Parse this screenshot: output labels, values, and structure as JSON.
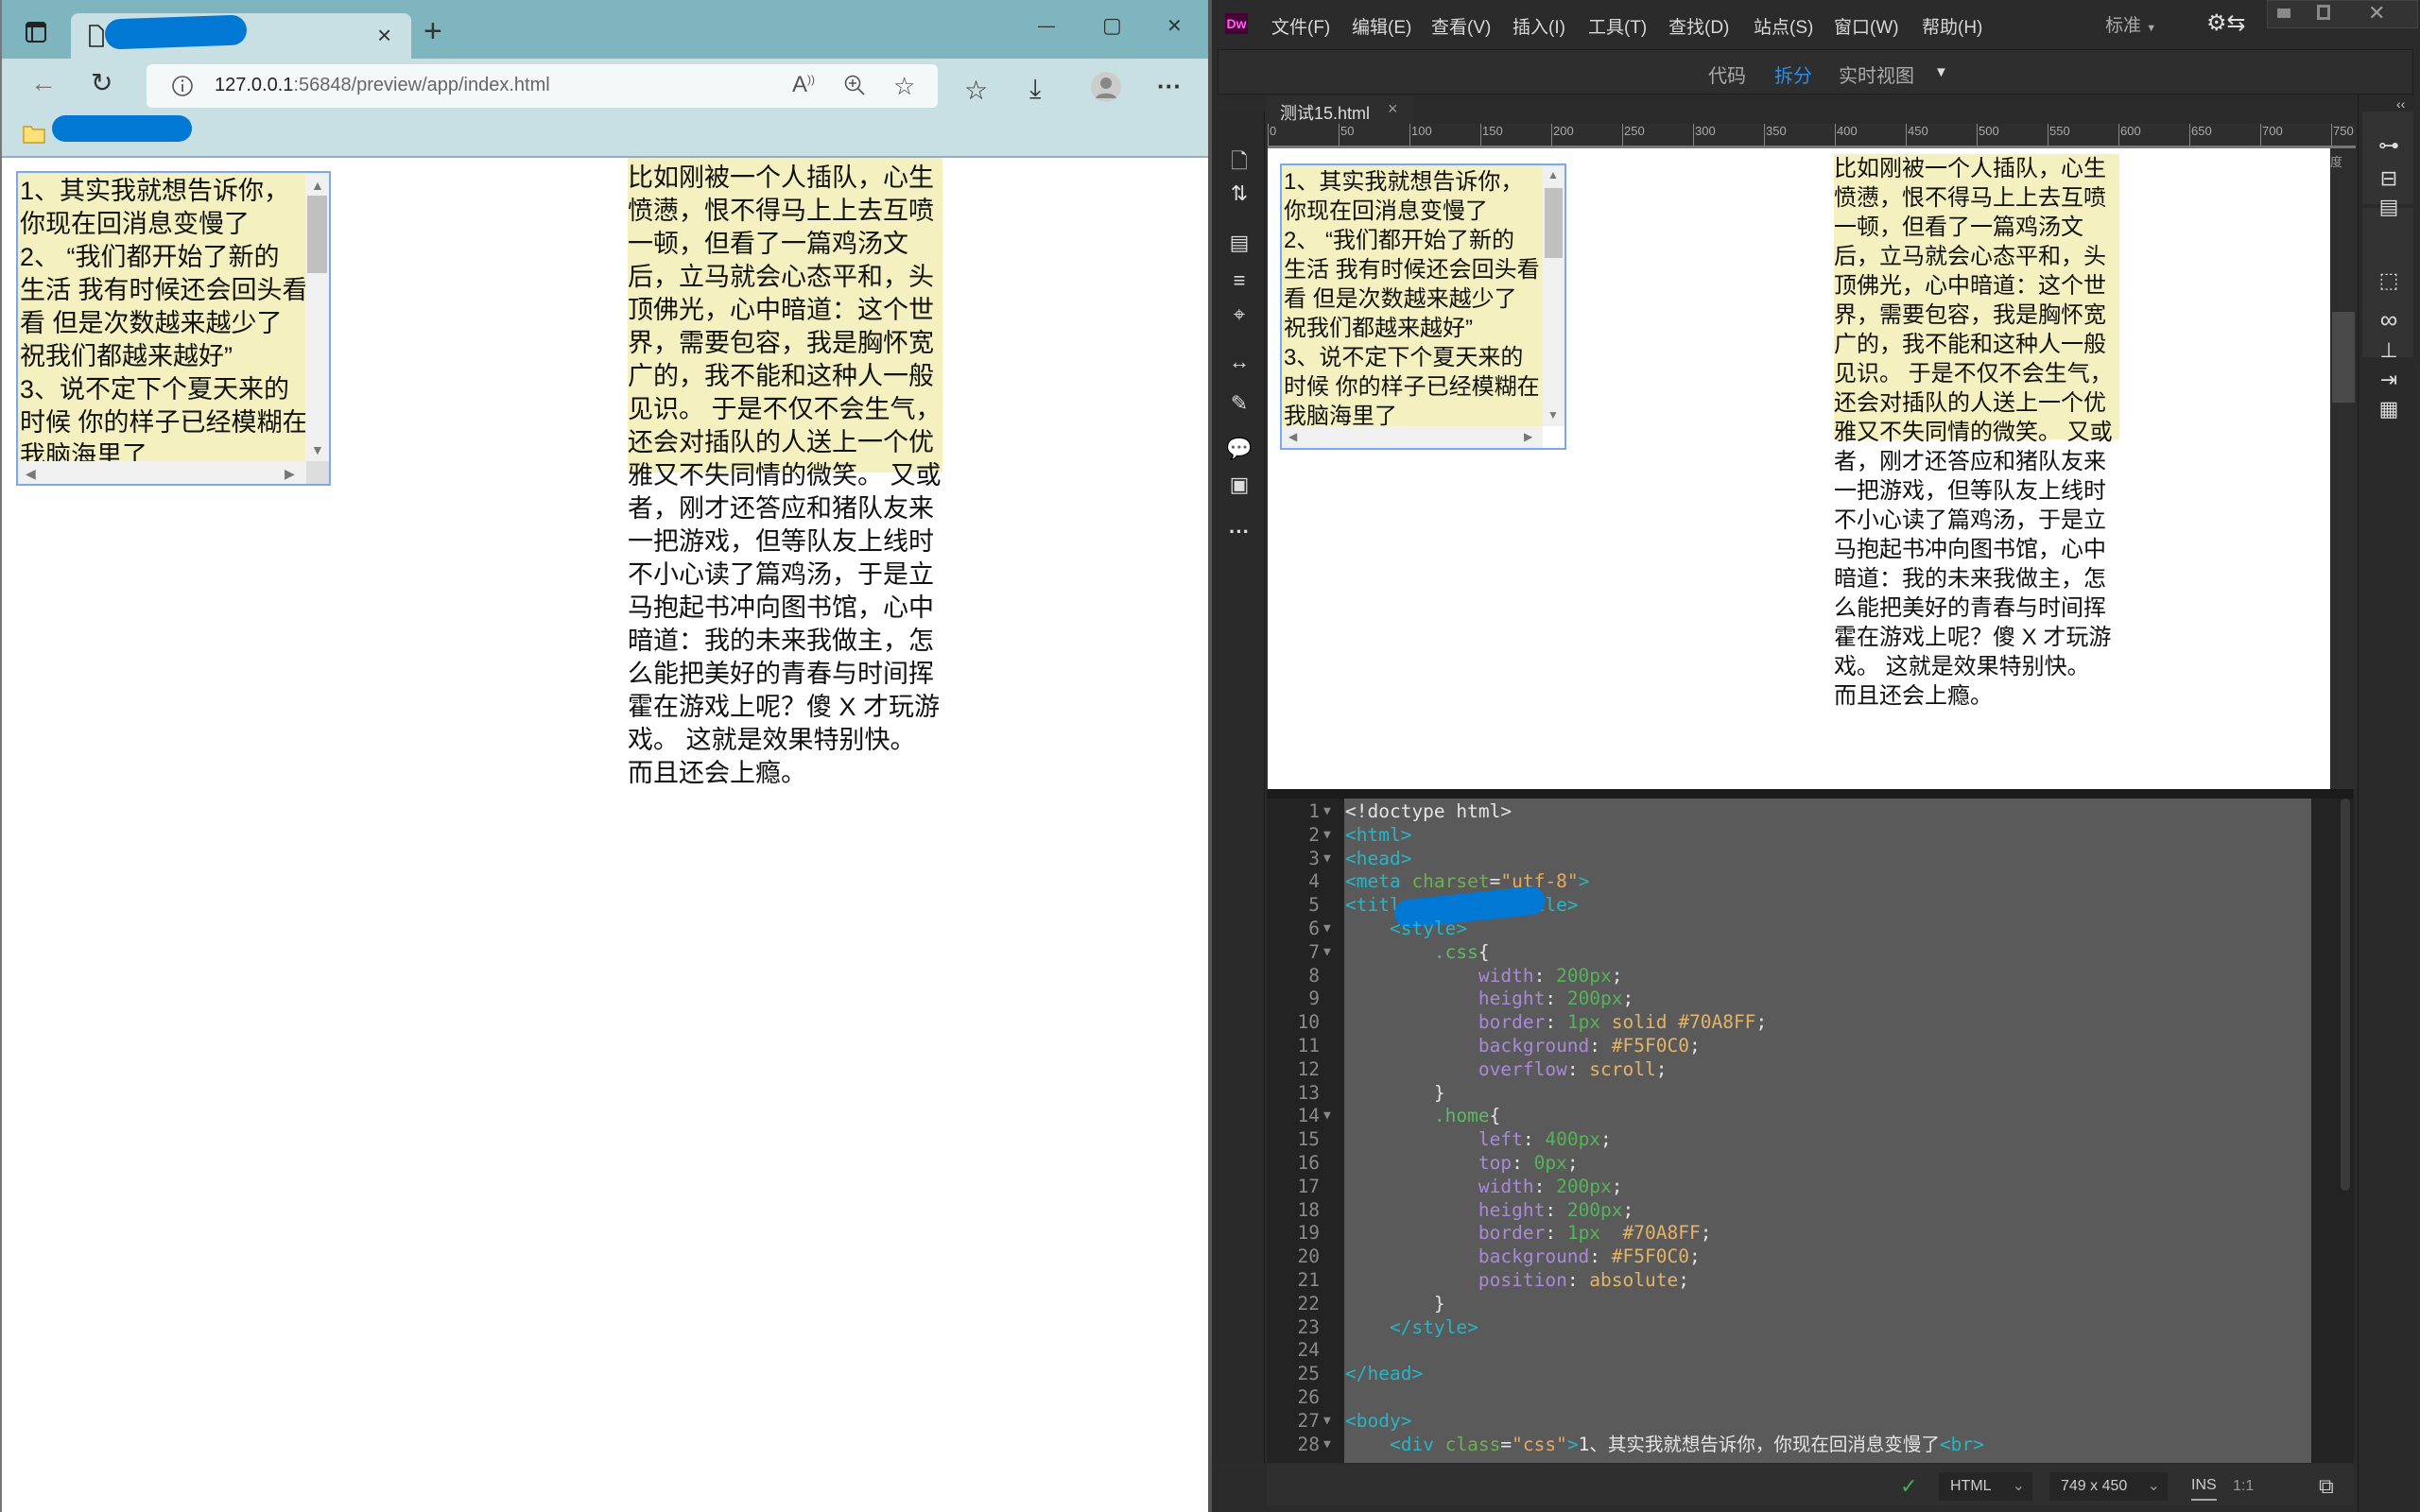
{
  "browser": {
    "tab_close": "×",
    "new_tab": "+",
    "url_host": "127.0.0.1",
    "url_path": ":56848/preview/app/index.html",
    "window": {
      "minimize": "—",
      "maximize": "▢",
      "close": "✕"
    },
    "icons": [
      "sidebar-icon",
      "page-icon",
      "back-icon",
      "refresh-icon",
      "info-icon",
      "read-aloud-icon",
      "zoom-icon",
      "add-favorite-icon",
      "favorites-icon",
      "download-icon",
      "profile-icon",
      "more-icon",
      "folder-icon"
    ],
    "more": "···"
  },
  "page": {
    "css_box_lines": [
      "1、其实我就想告诉你，",
      "你现在回消息变慢了",
      "2、 “我们都开始了新的",
      "生活 我有时候还会回头看",
      "看 但是次数越来越少了",
      "祝我们都越来越好”",
      "3、说不定下个夏天来的",
      "时候 你的样子已经模糊在",
      "我脑海里了"
    ],
    "home_lines": [
      "比如刚被一个人插队，心生",
      "愤懑，恨不得马上上去互喷",
      "一顿，但看了一篇鸡汤文",
      "后，立马就会心态平和，头",
      "顶佛光，心中暗道：这个世",
      "界，需要包容，我是胸怀宽",
      "广的，我不能和这种人一般",
      "见识。 于是不仅不会生气，",
      "还会对插队的人送上一个优",
      "雅又不失同情的微笑。 又或",
      "者，刚才还答应和猪队友来",
      "一把游戏，但等队友上线时",
      "不小心读了篇鸡汤，于是立",
      "马抱起书冲向图书馆，心中",
      "暗道：我的未来我做主，怎",
      "么能把美好的青春与时间挥",
      "霍在游戏上呢？傻 X 才玩游",
      "戏。 这就是效果特别快。",
      "而且还会上瘾。"
    ],
    "colors": {
      "box_border": "#70A8FF",
      "box_background": "#F5F0C0"
    }
  },
  "dw": {
    "logo": "Dw",
    "menu": [
      "文件(F)",
      "编辑(E)",
      "查看(V)",
      "插入(I)",
      "工具(T)",
      "查找(D)",
      "站点(S)",
      "窗口(W)",
      "帮助(H)"
    ],
    "workspace": "标准",
    "views": {
      "code": "代码",
      "split": "拆分",
      "live": "实时视图",
      "active": "拆分"
    },
    "accent": "#2d8ce6",
    "doc_tab": "测试15.html",
    "doc_tab_close": "×",
    "ruler": [
      "0",
      "50",
      "100",
      "150",
      "200",
      "250",
      "300",
      "350",
      "400",
      "450",
      "500",
      "550",
      "600",
      "650",
      "700",
      "750"
    ],
    "side_label": "度",
    "collapse": "‹‹",
    "code": {
      "lines": [
        {
          "n": "1",
          "fold": true,
          "tokens": [
            [
              "p",
              "<!doctype html>"
            ]
          ]
        },
        {
          "n": "2",
          "fold": true,
          "tokens": [
            [
              "tg",
              "<html>"
            ]
          ]
        },
        {
          "n": "3",
          "fold": true,
          "tokens": [
            [
              "tg",
              "<head>"
            ]
          ]
        },
        {
          "n": "4",
          "fold": false,
          "tokens": [
            [
              "tg",
              "<meta"
            ],
            [
              "at",
              " charset"
            ],
            [
              "p",
              "="
            ],
            [
              "st",
              "\"utf-8\""
            ],
            [
              "tg",
              ">"
            ]
          ]
        },
        {
          "n": "5",
          "fold": false,
          "tokens": [
            [
              "tg",
              "<titl"
            ],
            [
              "p",
              "          "
            ],
            [
              "tg",
              "title>"
            ]
          ]
        },
        {
          "n": "6",
          "fold": true,
          "tokens": [
            [
              "p",
              "    "
            ],
            [
              "tg",
              "<style>"
            ]
          ]
        },
        {
          "n": "7",
          "fold": true,
          "tokens": [
            [
              "p",
              "        "
            ],
            [
              "se",
              ".css"
            ],
            [
              "p",
              "{"
            ]
          ]
        },
        {
          "n": "8",
          "fold": false,
          "tokens": [
            [
              "p",
              "            "
            ],
            [
              "pr",
              "width"
            ],
            [
              "p",
              ": "
            ],
            [
              "nu",
              "200px"
            ],
            [
              "p",
              ";"
            ]
          ]
        },
        {
          "n": "9",
          "fold": false,
          "tokens": [
            [
              "p",
              "            "
            ],
            [
              "pr",
              "height"
            ],
            [
              "p",
              ": "
            ],
            [
              "nu",
              "200px"
            ],
            [
              "p",
              ";"
            ]
          ]
        },
        {
          "n": "10",
          "fold": false,
          "tokens": [
            [
              "p",
              "            "
            ],
            [
              "pr",
              "border"
            ],
            [
              "p",
              ": "
            ],
            [
              "nu",
              "1px"
            ],
            [
              "va",
              " solid #70A8FF"
            ],
            [
              "p",
              ";"
            ]
          ]
        },
        {
          "n": "11",
          "fold": false,
          "tokens": [
            [
              "p",
              "            "
            ],
            [
              "pr",
              "background"
            ],
            [
              "p",
              ": "
            ],
            [
              "va",
              "#F5F0C0"
            ],
            [
              "p",
              ";"
            ]
          ]
        },
        {
          "n": "12",
          "fold": false,
          "tokens": [
            [
              "p",
              "            "
            ],
            [
              "pr",
              "overflow"
            ],
            [
              "p",
              ": "
            ],
            [
              "va",
              "scroll"
            ],
            [
              "p",
              ";"
            ]
          ]
        },
        {
          "n": "13",
          "fold": false,
          "tokens": [
            [
              "p",
              "        }"
            ]
          ]
        },
        {
          "n": "14",
          "fold": true,
          "tokens": [
            [
              "p",
              "        "
            ],
            [
              "se",
              ".home"
            ],
            [
              "p",
              "{"
            ]
          ]
        },
        {
          "n": "15",
          "fold": false,
          "tokens": [
            [
              "p",
              "            "
            ],
            [
              "pr",
              "left"
            ],
            [
              "p",
              ": "
            ],
            [
              "nu",
              "400px"
            ],
            [
              "p",
              ";"
            ]
          ]
        },
        {
          "n": "16",
          "fold": false,
          "tokens": [
            [
              "p",
              "            "
            ],
            [
              "pr",
              "top"
            ],
            [
              "p",
              ": "
            ],
            [
              "nu",
              "0px"
            ],
            [
              "p",
              ";"
            ]
          ]
        },
        {
          "n": "17",
          "fold": false,
          "tokens": [
            [
              "p",
              "            "
            ],
            [
              "pr",
              "width"
            ],
            [
              "p",
              ": "
            ],
            [
              "nu",
              "200px"
            ],
            [
              "p",
              ";"
            ]
          ]
        },
        {
          "n": "18",
          "fold": false,
          "tokens": [
            [
              "p",
              "            "
            ],
            [
              "pr",
              "height"
            ],
            [
              "p",
              ": "
            ],
            [
              "nu",
              "200px"
            ],
            [
              "p",
              ";"
            ]
          ]
        },
        {
          "n": "19",
          "fold": false,
          "tokens": [
            [
              "p",
              "            "
            ],
            [
              "pr",
              "border"
            ],
            [
              "p",
              ": "
            ],
            [
              "nu",
              "1px"
            ],
            [
              "va",
              "  #70A8FF"
            ],
            [
              "p",
              ";"
            ]
          ]
        },
        {
          "n": "20",
          "fold": false,
          "tokens": [
            [
              "p",
              "            "
            ],
            [
              "pr",
              "background"
            ],
            [
              "p",
              ": "
            ],
            [
              "va",
              "#F5F0C0"
            ],
            [
              "p",
              ";"
            ]
          ]
        },
        {
          "n": "21",
          "fold": false,
          "tokens": [
            [
              "p",
              "            "
            ],
            [
              "pr",
              "position"
            ],
            [
              "p",
              ": "
            ],
            [
              "va",
              "absolute"
            ],
            [
              "p",
              ";"
            ]
          ]
        },
        {
          "n": "22",
          "fold": false,
          "tokens": [
            [
              "p",
              "        }"
            ]
          ]
        },
        {
          "n": "23",
          "fold": false,
          "tokens": [
            [
              "p",
              "    "
            ],
            [
              "tg",
              "</style>"
            ]
          ]
        },
        {
          "n": "24",
          "fold": false,
          "tokens": []
        },
        {
          "n": "25",
          "fold": false,
          "tokens": [
            [
              "tg",
              "</head>"
            ]
          ]
        },
        {
          "n": "26",
          "fold": false,
          "tokens": []
        },
        {
          "n": "27",
          "fold": true,
          "tokens": [
            [
              "tg",
              "<body>"
            ]
          ]
        },
        {
          "n": "28",
          "fold": true,
          "tokens": [
            [
              "p",
              "    "
            ],
            [
              "tg",
              "<div"
            ],
            [
              "at",
              " class"
            ],
            [
              "p",
              "="
            ],
            [
              "st",
              "\"css\""
            ],
            [
              "tg",
              ">"
            ],
            [
              "p",
              "1、其实我就想告诉你，你现在回消息变慢了"
            ],
            [
              "tg",
              "<br>"
            ]
          ]
        }
      ]
    },
    "status": {
      "language": "HTML",
      "size": "749 x 450",
      "mode": "INS",
      "ratio": "1:1"
    }
  }
}
